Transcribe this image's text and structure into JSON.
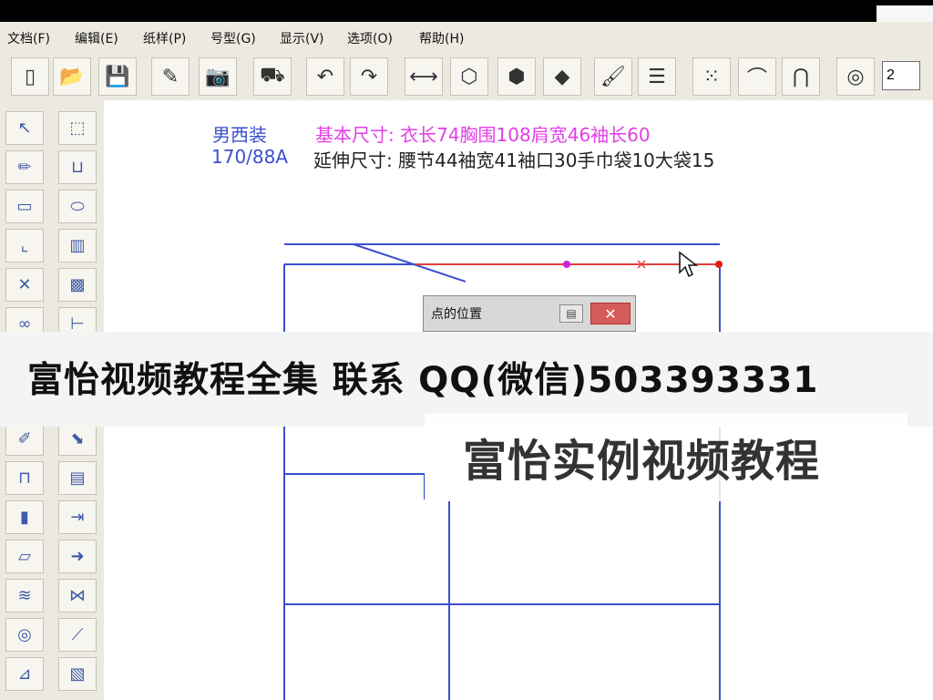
{
  "menu": [
    {
      "label": "文档(F)"
    },
    {
      "label": "编辑(E)"
    },
    {
      "label": "纸样(P)"
    },
    {
      "label": "号型(G)"
    },
    {
      "label": "显示(V)"
    },
    {
      "label": "选项(O)"
    },
    {
      "label": "帮助(H)"
    }
  ],
  "toolbar": {
    "buttons": [
      {
        "icon": "new-document-icon"
      },
      {
        "icon": "open-folder-icon"
      },
      {
        "icon": "save-icon"
      },
      {
        "icon": "spray-icon"
      },
      {
        "icon": "camera-icon"
      },
      {
        "icon": "plotter-icon"
      },
      {
        "icon": "undo-icon"
      },
      {
        "icon": "redo-icon"
      },
      {
        "icon": "measure-line-icon"
      },
      {
        "icon": "pattern-block-icon"
      },
      {
        "icon": "shield-shape-icon"
      },
      {
        "icon": "shapes-icon"
      },
      {
        "icon": "brush-icon"
      },
      {
        "icon": "layers-icon"
      },
      {
        "icon": "dot-grid-icon"
      },
      {
        "icon": "curve-icon"
      },
      {
        "icon": "pattern-shape-icon"
      },
      {
        "icon": "color-wheel-icon"
      }
    ],
    "input_value": "2"
  },
  "left_tools": {
    "col1": [
      {
        "icon": "arrow-select-icon"
      },
      {
        "icon": "pencil-icon"
      },
      {
        "icon": "rectangle-icon"
      },
      {
        "icon": "corner-curve-icon"
      },
      {
        "icon": "intersection-icon"
      },
      {
        "icon": "chain-icon"
      },
      {
        "icon": "ruler-pencil-icon"
      },
      {
        "icon": "pocket-icon"
      },
      {
        "icon": "piece-icon"
      },
      {
        "icon": "fold-icon"
      },
      {
        "icon": "wave-icon"
      },
      {
        "icon": "spiral-icon"
      },
      {
        "icon": "tape-icon"
      }
    ],
    "col2": [
      {
        "icon": "transform-icon"
      },
      {
        "icon": "pocket-shape-icon"
      },
      {
        "icon": "shape-outline-icon"
      },
      {
        "icon": "blue-panel-icon"
      },
      {
        "icon": "green-panel-icon"
      },
      {
        "icon": "tape-measure-icon"
      },
      {
        "icon": "pattern-corner-icon"
      },
      {
        "icon": "machine-icon"
      },
      {
        "icon": "piece-edit-icon"
      },
      {
        "icon": "move-arrow-icon"
      },
      {
        "icon": "vest-icon"
      },
      {
        "icon": "dimension-icon"
      },
      {
        "icon": "cut-icon"
      }
    ]
  },
  "info": {
    "line1_left": "男西装",
    "line1_right": "基本尺寸: 衣长74胸围108肩宽46袖长60",
    "line2_left": "170/88A",
    "line2_right": "延伸尺寸: 腰节44袖宽41袖口30手巾袋10大袋15"
  },
  "dialog": {
    "title": "点的位置"
  },
  "banner": {
    "text": "富怡视频教程全集 联系 QQ(微信)503393331"
  },
  "subtitle": {
    "text": "富怡实例视频教程"
  },
  "colors": {
    "toolbar_bg": "#ece9e0",
    "line_blue": "#3b4fcf",
    "line_red": "#e23f3f",
    "accent_magenta": "#e23fe6"
  }
}
